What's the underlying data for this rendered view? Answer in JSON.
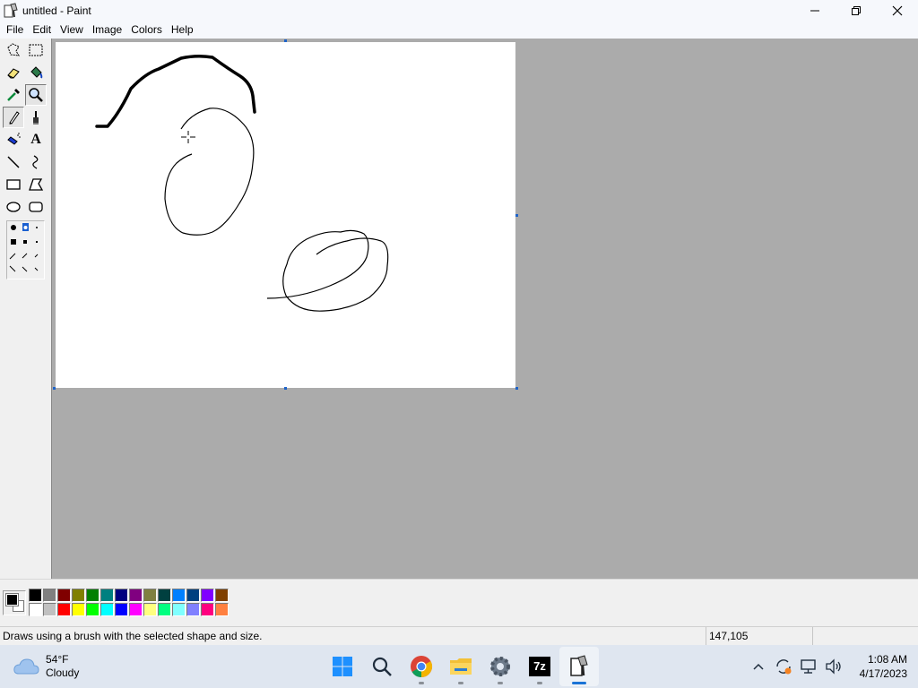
{
  "window": {
    "title": "untitled - Paint",
    "minimize_glyph": "—",
    "maximize_glyph": "❐",
    "close_glyph": "✕"
  },
  "menu": [
    "File",
    "Edit",
    "View",
    "Image",
    "Colors",
    "Help"
  ],
  "toolbox": {
    "tools": [
      {
        "name": "free-form-select",
        "active": false
      },
      {
        "name": "rect-select",
        "active": false
      },
      {
        "name": "eraser",
        "active": false
      },
      {
        "name": "fill",
        "active": false
      },
      {
        "name": "color-picker",
        "active": false
      },
      {
        "name": "magnifier",
        "active": true
      },
      {
        "name": "pencil",
        "active": true
      },
      {
        "name": "brush",
        "active": false
      },
      {
        "name": "airbrush",
        "active": false
      },
      {
        "name": "text",
        "active": false
      },
      {
        "name": "line",
        "active": false
      },
      {
        "name": "curve",
        "active": false
      },
      {
        "name": "rectangle",
        "active": false
      },
      {
        "name": "polygon",
        "active": false
      },
      {
        "name": "ellipse",
        "active": false
      },
      {
        "name": "rounded-rect",
        "active": false
      }
    ],
    "text_tool_glyph": "A"
  },
  "palette": {
    "foreground": "#000000",
    "background": "#ffffff",
    "colors_row1": [
      "#000000",
      "#808080",
      "#800000",
      "#808000",
      "#008000",
      "#008080",
      "#000080",
      "#800080",
      "#808040",
      "#004040",
      "#0080ff",
      "#004080",
      "#8000ff",
      "#804000"
    ],
    "colors_row2": [
      "#ffffff",
      "#c0c0c0",
      "#ff0000",
      "#ffff00",
      "#00ff00",
      "#00ffff",
      "#0000ff",
      "#ff00ff",
      "#ffff80",
      "#00ff80",
      "#80ffff",
      "#8080ff",
      "#ff0080",
      "#ff8040"
    ]
  },
  "status": {
    "hint": "Draws using a brush with the selected shape and size.",
    "coords": "147,105",
    "size": ""
  },
  "taskbar": {
    "weather_temp": "54°F",
    "weather_cond": "Cloudy",
    "seven_zip_label": "7z",
    "time": "1:08 AM",
    "date": "4/17/2023"
  }
}
